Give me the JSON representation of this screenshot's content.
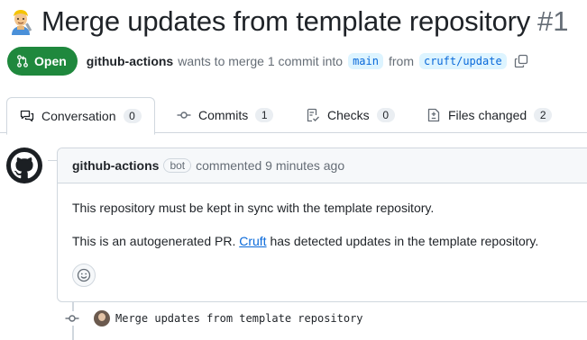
{
  "title": {
    "emoji": "man-mechanic-emoji",
    "text": "Merge updates from template repository",
    "number": "#1"
  },
  "meta": {
    "state": "Open",
    "author": "github-actions",
    "wants_to_merge": "wants to merge 1 commit into",
    "base_branch": "main",
    "from": "from",
    "head_branch": "cruft/update"
  },
  "tabs": [
    {
      "label": "Conversation",
      "count": "0",
      "icon": "comment-discussion-icon"
    },
    {
      "label": "Commits",
      "count": "1",
      "icon": "git-commit-icon"
    },
    {
      "label": "Checks",
      "count": "0",
      "icon": "checklist-icon"
    },
    {
      "label": "Files changed",
      "count": "2",
      "icon": "file-diff-icon"
    }
  ],
  "comment": {
    "author": "github-actions",
    "bot_label": "bot",
    "action": "commented 9 minutes ago",
    "para1": "This repository must be kept in sync with the template repository.",
    "para2_before": "This is an autogenerated PR.",
    "para2_link": "Cruft",
    "para2_after": "has detected updates in the template repository."
  },
  "commit": {
    "message": "Merge updates from template repository"
  },
  "colors": {
    "open_green": "#1f883d",
    "link_blue": "#0969da",
    "branch_bg": "#ddf4ff",
    "muted": "#656d76",
    "border": "#d0d7de"
  }
}
